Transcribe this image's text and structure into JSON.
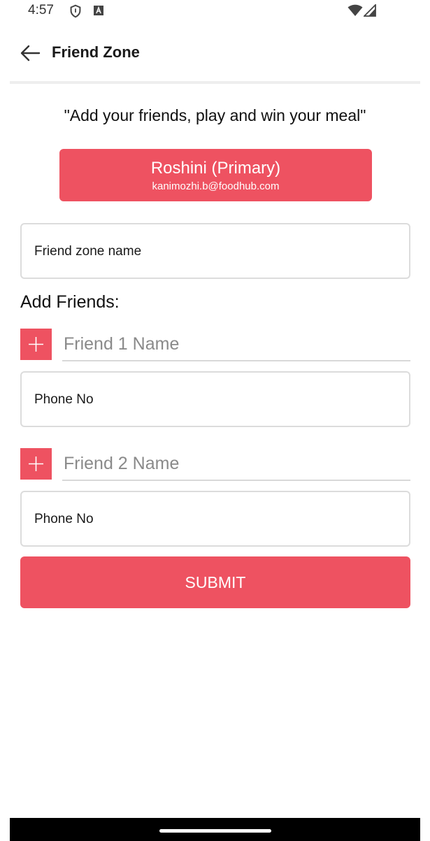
{
  "status_bar": {
    "time": "4:57",
    "icons": [
      "shield-icon",
      "a-badge-icon",
      "wifi-icon",
      "signal-icon"
    ]
  },
  "toolbar": {
    "title": "Friend Zone",
    "back_icon": "arrow-left-icon"
  },
  "tagline": "\"Add your friends, play and win your meal\"",
  "primary_user": {
    "name": "Roshini (Primary)",
    "email": "kanimozhi.b@foodhub.com"
  },
  "friend_zone_name": {
    "placeholder": "Friend zone name",
    "value": ""
  },
  "add_friends": {
    "title": "Add Friends:",
    "friends": [
      {
        "name_placeholder": "Friend 1 Name",
        "phone_placeholder": "Phone No",
        "add_icon": "plus-icon"
      },
      {
        "name_placeholder": "Friend 2 Name",
        "phone_placeholder": "Phone No",
        "add_icon": "plus-icon"
      }
    ]
  },
  "submit_label": "SUBMIT",
  "colors": {
    "accent": "#ee5261",
    "border": "#dcdcdc",
    "placeholder": "#8a8a8a"
  }
}
